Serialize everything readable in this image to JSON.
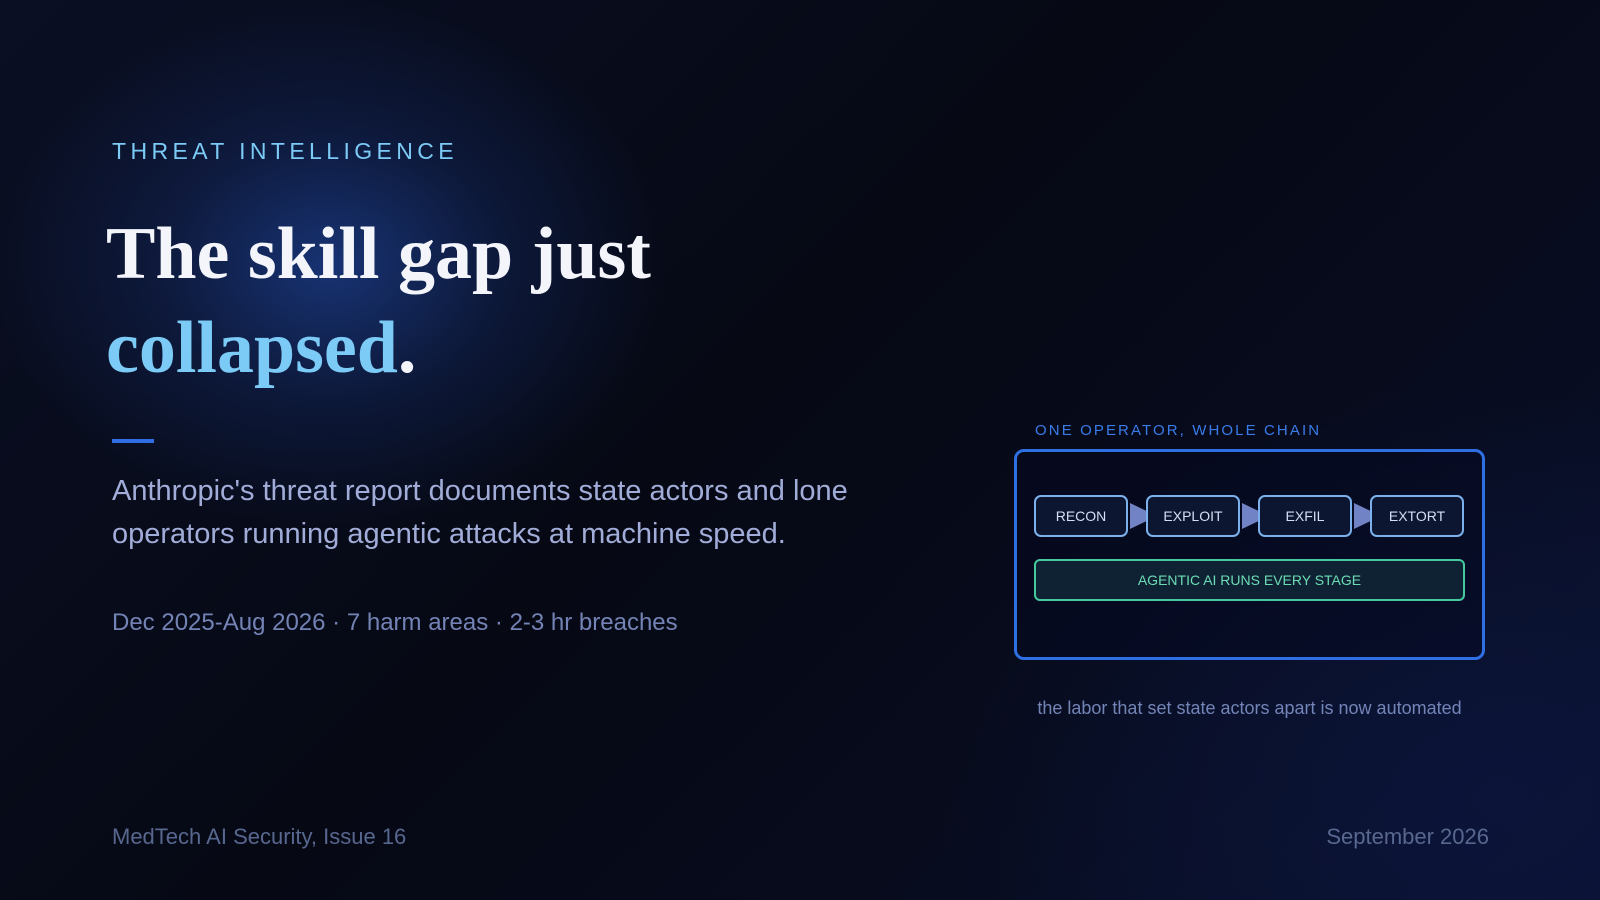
{
  "eyebrow": "THREAT INTELLIGENCE",
  "headline": {
    "line1": "The skill gap just",
    "accent": "collapsed",
    "period": "."
  },
  "description": "Anthropic's threat report documents state actors and lone operators running agentic attacks at machine speed.",
  "meta": {
    "period": "Dec 2025-Aug 2026",
    "harm_areas": "7 harm areas",
    "breach_time": "2-3 hr breaches",
    "separator": " · "
  },
  "diagram": {
    "label": "ONE OPERATOR, WHOLE CHAIN",
    "stages": [
      "RECON",
      "EXPLOIT",
      "EXFIL",
      "EXTORT"
    ],
    "bar": "AGENTIC AI RUNS EVERY STAGE",
    "caption": "the labor that set state actors apart is now automated"
  },
  "footer": {
    "publication": "MedTech AI Security, Issue 16",
    "date": "September 2026"
  },
  "colors": {
    "accent": "#7ccaf6",
    "frame": "#2e6fe3",
    "agentic": "#47c9a0",
    "text_muted": "#7483b5"
  }
}
